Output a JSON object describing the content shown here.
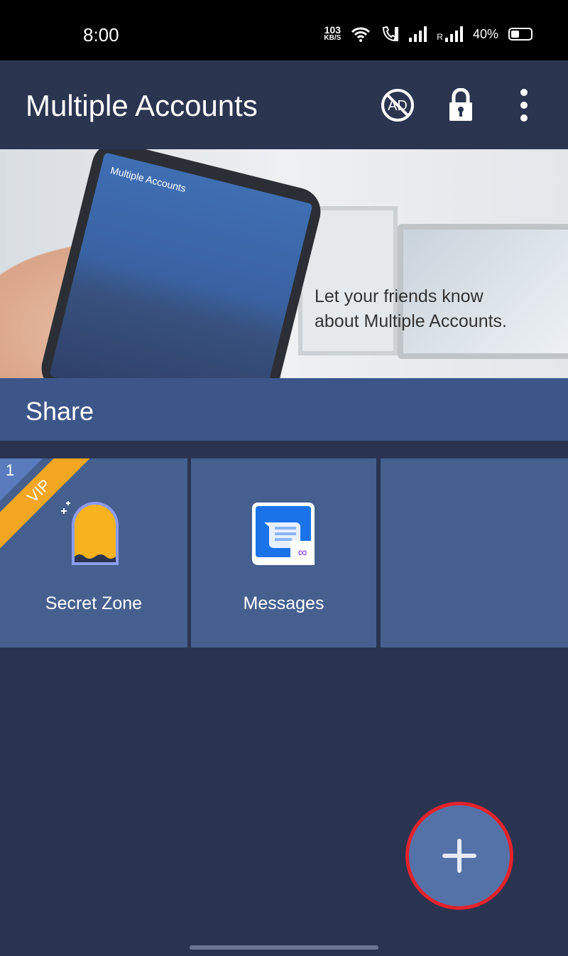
{
  "status_bar": {
    "time": "8:00",
    "net_speed": "103",
    "net_unit": "KB/S",
    "roaming": "R",
    "battery": "40%"
  },
  "app_bar": {
    "title": "Multiple Accounts",
    "icons": [
      "no-ads-icon",
      "lock-icon",
      "more-vert-icon"
    ],
    "ad_glyph": "AD"
  },
  "banner": {
    "line1": "Let your friends know",
    "line2": "about Multiple Accounts.",
    "phone_title": "Multiple Accounts"
  },
  "share": {
    "label": "Share"
  },
  "tiles": [
    {
      "label": "Secret Zone",
      "badge": "VIP",
      "badge_count": "1",
      "icon": "curtain-icon"
    },
    {
      "label": "Messages",
      "icon": "messages-icon"
    },
    {
      "label": ""
    }
  ],
  "fab": {
    "icon": "plus-icon"
  },
  "colors": {
    "accent": "#5472a8",
    "fab_ring": "#e3232c",
    "vip": "#f5a623",
    "tile": "#45608f",
    "background": "#2a3450"
  }
}
